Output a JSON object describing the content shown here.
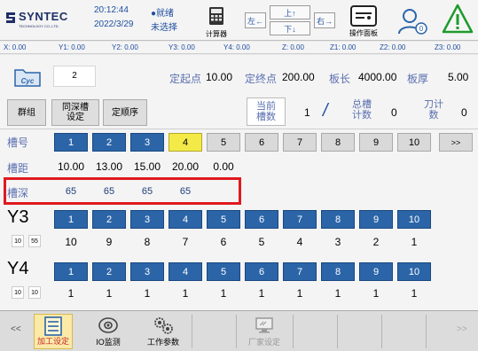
{
  "header": {
    "brand": "SYNTEC",
    "brand_sub": "TECHNOLOGY CO.,LTD.",
    "time": "20:12:44",
    "date": "2022/3/29",
    "status": "●就绪",
    "selection": "未选择",
    "calculator_label": "计算器",
    "arrows": {
      "up": "上↑",
      "down": "下↓",
      "left": "左←",
      "right": "右→"
    },
    "operation_panel_label": "操作面板"
  },
  "coords": [
    {
      "label": "X:",
      "value": "0.00"
    },
    {
      "label": "Y1:",
      "value": "0.00"
    },
    {
      "label": "Y2:",
      "value": "0.00"
    },
    {
      "label": "Y3:",
      "value": "0.00"
    },
    {
      "label": "Y4:",
      "value": "0.00"
    },
    {
      "label": "Z:",
      "value": "0.00"
    },
    {
      "label": "Z1:",
      "value": "0.00"
    },
    {
      "label": "Z2:",
      "value": "0.00"
    },
    {
      "label": "Z3:",
      "value": "0.00"
    }
  ],
  "params": {
    "cyc_label": "Cyc",
    "cycle_value": "2",
    "start_label": "定起点",
    "start_value": "10.00",
    "end_label": "定终点",
    "end_value": "200.00",
    "board_length_label": "板长",
    "board_length_value": "4000.00",
    "board_thickness_label": "板厚",
    "board_thickness_value": "5.00"
  },
  "toolbar": {
    "group_label": "群组",
    "same_depth_label": "同深槽设定",
    "order_label": "定顺序",
    "current_slots_label": "当前槽数",
    "current_slots_value": "1",
    "slash": "/",
    "total_slots_label": "总槽计数",
    "total_slots_value": "0",
    "tool_count_label": "刀计数",
    "tool_count_value": "0"
  },
  "grid": {
    "slot_label": "槽号",
    "slots": [
      "1",
      "2",
      "3",
      "4",
      "5",
      "6",
      "7",
      "8",
      "9",
      "10"
    ],
    "more_label": ">>",
    "pitch_label": "槽距",
    "pitch": [
      "10.00",
      "13.00",
      "15.00",
      "20.00",
      "0.00"
    ],
    "depth_label": "槽深",
    "depth": [
      "65",
      "65",
      "65",
      "65"
    ],
    "y3_label": "Y3",
    "y3_mini": [
      "10",
      "55"
    ],
    "y3_index": [
      "1",
      "2",
      "3",
      "4",
      "5",
      "6",
      "7",
      "8",
      "9",
      "10"
    ],
    "y3_values": [
      "10",
      "9",
      "8",
      "7",
      "6",
      "5",
      "4",
      "3",
      "2",
      "1"
    ],
    "y4_label": "Y4",
    "y4_mini": [
      "10",
      "10"
    ],
    "y4_index": [
      "1",
      "2",
      "3",
      "4",
      "5",
      "6",
      "7",
      "8",
      "9",
      "10"
    ],
    "y4_values": [
      "1",
      "1",
      "1",
      "1",
      "1",
      "1",
      "1",
      "1",
      "1",
      "1"
    ]
  },
  "bottom": {
    "prev": "<<",
    "next": ">>",
    "buttons": [
      {
        "label": "加工设定",
        "icon": "list-icon",
        "active": true
      },
      {
        "label": "IO监测",
        "icon": "io-monitor-icon",
        "active": false
      },
      {
        "label": "工作参数",
        "icon": "gears-icon",
        "active": false
      },
      {
        "label": "厂家设定",
        "icon": "factory-settings-icon",
        "active": false,
        "disabled": true
      }
    ]
  },
  "colors": {
    "accent_blue": "#2b65a8",
    "selected_yellow": "#f3ea48",
    "highlight_red": "#e0191f",
    "label_blue": "#5a6fb0"
  }
}
